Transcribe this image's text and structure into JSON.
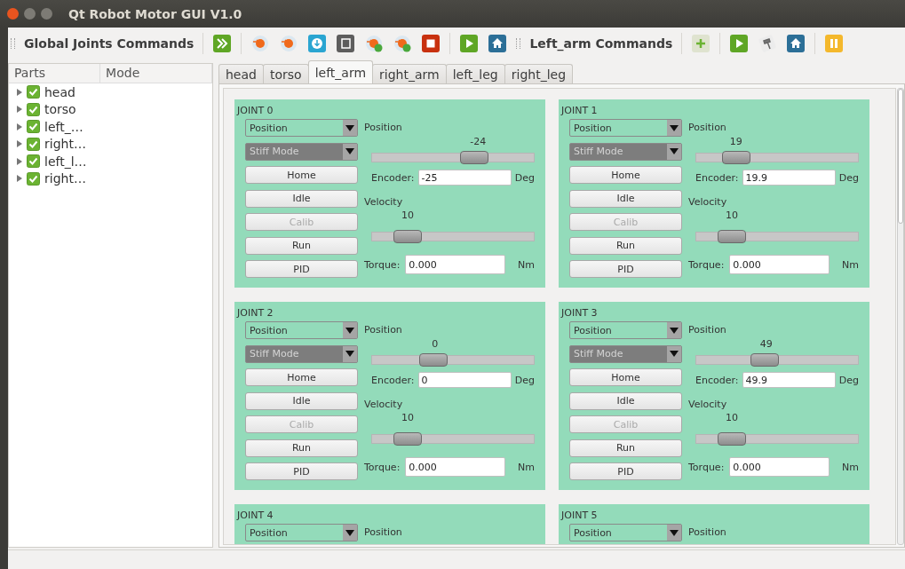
{
  "window": {
    "title": "Qt Robot Motor GUI V1.0"
  },
  "toolbars": [
    {
      "title": "Global Joints Commands"
    },
    {
      "title": "Left_arm Commands"
    }
  ],
  "parts_tree": {
    "columns": [
      "Parts",
      "Mode"
    ],
    "items": [
      {
        "label": "head",
        "checked": true,
        "expanded": false
      },
      {
        "label": "torso",
        "checked": true,
        "expanded": false
      },
      {
        "label": "left_…",
        "checked": true,
        "expanded": false
      },
      {
        "label": "right…",
        "checked": true,
        "expanded": false
      },
      {
        "label": "left_l…",
        "checked": true,
        "expanded": false
      },
      {
        "label": "right…",
        "checked": true,
        "expanded": false
      }
    ]
  },
  "tabs": [
    {
      "label": "head",
      "selected": false
    },
    {
      "label": "torso",
      "selected": false
    },
    {
      "label": "left_arm",
      "selected": true
    },
    {
      "label": "right_arm",
      "selected": false
    },
    {
      "label": "left_leg",
      "selected": false
    },
    {
      "label": "right_leg",
      "selected": false
    }
  ],
  "joints": [
    {
      "title": "JOINT 0",
      "mode": "Position",
      "interaction": {
        "value": "Stiff Mode",
        "disabled": true
      },
      "buttons": [
        {
          "label": "Home",
          "disabled": false
        },
        {
          "label": "Idle",
          "disabled": false
        },
        {
          "label": "Calib",
          "disabled": true
        },
        {
          "label": "Run",
          "disabled": false
        },
        {
          "label": "PID",
          "disabled": false
        }
      ],
      "position": {
        "label": "Position",
        "value": "-24",
        "level": 0.65
      },
      "encoder": {
        "label": "Encoder:",
        "value": "-25",
        "unit": "Deg"
      },
      "velocity": {
        "label": "Velocity",
        "value": "10",
        "level": 0.16
      },
      "torque": {
        "label": "Torque:",
        "value": "0.000",
        "unit": "Nm"
      }
    },
    {
      "title": "JOINT 1",
      "mode": "Position",
      "interaction": {
        "value": "Stiff Mode",
        "disabled": true
      },
      "buttons": [
        {
          "label": "Home",
          "disabled": false
        },
        {
          "label": "Idle",
          "disabled": false
        },
        {
          "label": "Calib",
          "disabled": true
        },
        {
          "label": "Run",
          "disabled": false
        },
        {
          "label": "PID",
          "disabled": false
        }
      ],
      "position": {
        "label": "Position",
        "value": "19",
        "level": 0.19
      },
      "encoder": {
        "label": "Encoder:",
        "value": "19.9",
        "unit": "Deg"
      },
      "velocity": {
        "label": "Velocity",
        "value": "10",
        "level": 0.16
      },
      "torque": {
        "label": "Torque:",
        "value": "0.000",
        "unit": "Nm"
      }
    },
    {
      "title": "JOINT 2",
      "mode": "Position",
      "interaction": {
        "value": "Stiff Mode",
        "disabled": true
      },
      "buttons": [
        {
          "label": "Home",
          "disabled": false
        },
        {
          "label": "Idle",
          "disabled": false
        },
        {
          "label": "Calib",
          "disabled": true
        },
        {
          "label": "Run",
          "disabled": false
        },
        {
          "label": "PID",
          "disabled": false
        }
      ],
      "position": {
        "label": "Position",
        "value": "0",
        "level": 0.35
      },
      "encoder": {
        "label": "Encoder:",
        "value": "0",
        "unit": "Deg"
      },
      "velocity": {
        "label": "Velocity",
        "value": "10",
        "level": 0.16
      },
      "torque": {
        "label": "Torque:",
        "value": "0.000",
        "unit": "Nm"
      }
    },
    {
      "title": "JOINT 3",
      "mode": "Position",
      "interaction": {
        "value": "Stiff Mode",
        "disabled": true
      },
      "buttons": [
        {
          "label": "Home",
          "disabled": false
        },
        {
          "label": "Idle",
          "disabled": false
        },
        {
          "label": "Calib",
          "disabled": true
        },
        {
          "label": "Run",
          "disabled": false
        },
        {
          "label": "PID",
          "disabled": false
        }
      ],
      "position": {
        "label": "Position",
        "value": "49",
        "level": 0.4
      },
      "encoder": {
        "label": "Encoder:",
        "value": "49.9",
        "unit": "Deg"
      },
      "velocity": {
        "label": "Velocity",
        "value": "10",
        "level": 0.16
      },
      "torque": {
        "label": "Torque:",
        "value": "0.000",
        "unit": "Nm"
      }
    },
    {
      "title": "JOINT 4",
      "mode": "Position",
      "position": {
        "label": "Position"
      }
    },
    {
      "title": "JOINT 5",
      "mode": "Position",
      "position": {
        "label": "Position"
      }
    }
  ]
}
